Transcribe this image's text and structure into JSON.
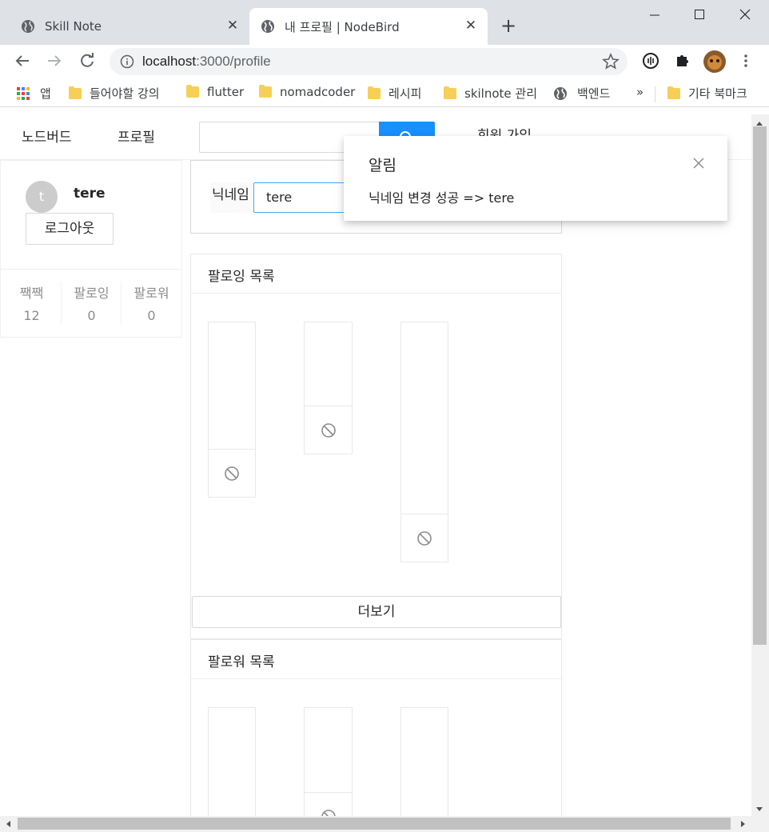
{
  "browser": {
    "tabs": [
      {
        "title": "Skill Note",
        "active": false
      },
      {
        "title": "내 프로필 | NodeBird",
        "active": true
      }
    ],
    "url_host": "localhost",
    "url_path": ":3000/profile",
    "bookmarks": [
      "앱",
      "들어야할 강의",
      "flutter",
      "nomadcoder",
      "레시피",
      "skilnote 관리",
      "백엔드",
      "»",
      "기타 북마크"
    ]
  },
  "header": {
    "nav": [
      "노드버드",
      "프로필"
    ],
    "signup": "회원 가입"
  },
  "profile": {
    "avatar_letter": "t",
    "username": "tere",
    "logout_label": "로그아웃",
    "stats": [
      {
        "label": "짹짹",
        "value": "12"
      },
      {
        "label": "팔로잉",
        "value": "0"
      },
      {
        "label": "팔로워",
        "value": "0"
      }
    ]
  },
  "nickname_form": {
    "label": "닉네임",
    "value": "tere"
  },
  "following": {
    "title": "팔로잉 목록",
    "more_label": "더보기"
  },
  "followers": {
    "title": "팔로워 목록"
  },
  "notification": {
    "title": "알림",
    "description": "닉네임 변경 성공 => tere"
  },
  "colors": {
    "primary": "#1890ff",
    "border": "#d9d9d9"
  }
}
